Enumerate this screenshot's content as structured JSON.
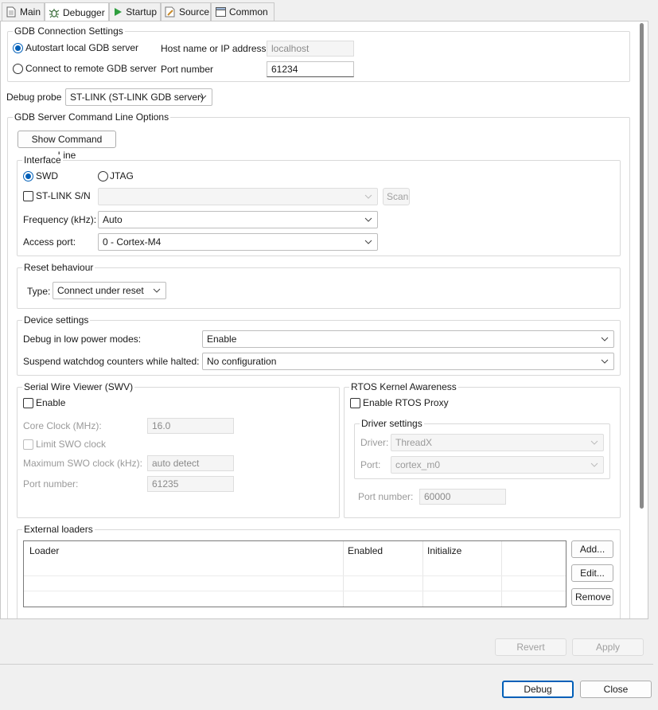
{
  "tabs": [
    {
      "label": "Main",
      "icon": "document-icon"
    },
    {
      "label": "Debugger",
      "icon": "bug-icon"
    },
    {
      "label": "Startup",
      "icon": "play-icon"
    },
    {
      "label": "Source",
      "icon": "source-icon"
    },
    {
      "label": "Common",
      "icon": "window-icon"
    }
  ],
  "gdb_connection": {
    "title": "GDB Connection Settings",
    "autostart_label": "Autostart local GDB server",
    "remote_label": "Connect to remote GDB server",
    "host_label": "Host name or IP address",
    "host_value": "localhost",
    "port_label": "Port number",
    "port_value": "61234"
  },
  "debug_probe": {
    "label": "Debug probe",
    "value": "ST-LINK (ST-LINK GDB server)"
  },
  "gdb_server": {
    "title": "GDB Server Command Line Options",
    "show_cmd_label": "Show Command Line"
  },
  "interface": {
    "title": "Interface",
    "swd_label": "SWD",
    "jtag_label": "JTAG",
    "stlink_sn_label": "ST-LINK S/N",
    "stlink_sn_value": "",
    "scan_label": "Scan",
    "frequency_label": "Frequency (kHz):",
    "frequency_value": "Auto",
    "access_port_label": "Access port:",
    "access_port_value": "0 - Cortex-M4"
  },
  "reset": {
    "title": "Reset behaviour",
    "type_label": "Type:",
    "type_value": "Connect under reset"
  },
  "device": {
    "title": "Device settings",
    "low_power_label": "Debug in low power modes:",
    "low_power_value": "Enable",
    "watchdog_label": "Suspend watchdog counters while halted:",
    "watchdog_value": "No configuration"
  },
  "swv": {
    "title": "Serial Wire Viewer (SWV)",
    "enable_label": "Enable",
    "core_clock_label": "Core Clock (MHz):",
    "core_clock_value": "16.0",
    "limit_swo_label": "Limit SWO clock",
    "max_swo_label": "Maximum SWO clock (kHz):",
    "max_swo_value": "auto detect",
    "port_label": "Port number:",
    "port_value": "61235"
  },
  "rtos": {
    "title": "RTOS Kernel Awareness",
    "enable_label": "Enable RTOS Proxy",
    "driver_settings_title": "Driver settings",
    "driver_label": "Driver:",
    "driver_value": "ThreadX",
    "port_label": "Port:",
    "port_value": "cortex_m0",
    "port_number_label": "Port number:",
    "port_number_value": "60000"
  },
  "loaders": {
    "title": "External loaders",
    "columns": [
      "Loader",
      "Enabled",
      "Initialize"
    ],
    "add_label": "Add...",
    "edit_label": "Edit...",
    "remove_label": "Remove"
  },
  "footer": {
    "revert_label": "Revert",
    "apply_label": "Apply",
    "debug_label": "Debug",
    "close_label": "Close"
  },
  "colors": {
    "accent": "#005fb8",
    "startup_icon": "#2e9e3e"
  }
}
